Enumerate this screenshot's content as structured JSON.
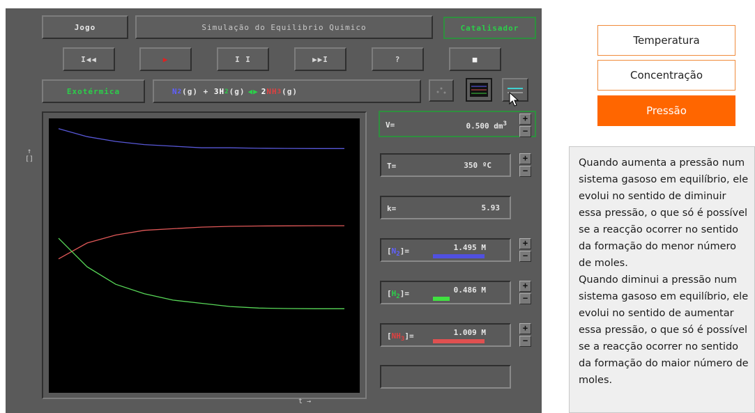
{
  "sim": {
    "jogo_button": "Jogo",
    "title": "Simulação do Equilibrio Quimico",
    "catalyst_button": "Catalisador",
    "exothermic_label": "Exotérmica",
    "media_buttons": {
      "rewind": "I◀◀",
      "play": "▶",
      "pause": "I I",
      "fast_forward": "▶▶I",
      "help": "?",
      "stop": "■"
    },
    "equation": {
      "n2": "N",
      "n2_sub": "2",
      "n2_state": "(g) + ",
      "h2_coef": "3H",
      "h2_sub": "2",
      "h2_state": "(g) ",
      "arrow": "◀▶",
      "nh3_coef": "2",
      "nh3": "NH",
      "nh3_sub": "3",
      "nh3_state": "(g)"
    },
    "axis_y": "↑\n[]",
    "axis_x": "t →",
    "readouts": {
      "V": {
        "label": "V=",
        "value": "0.500 dm",
        "unit_sup": "3"
      },
      "T": {
        "label": "T=",
        "value": "350 ºC"
      },
      "K": {
        "label": "k=",
        "value": "5.93"
      },
      "N2": {
        "label_open": "[",
        "label_species": "N",
        "label_sub": "2",
        "label_close": "]=",
        "value": "1.495 M",
        "level": 0.74
      },
      "H2": {
        "label_open": "[",
        "label_species": "H",
        "label_sub": "2",
        "label_close": "]=",
        "value": "0.486 M",
        "level": 0.24
      },
      "NH3": {
        "label_open": "[",
        "label_species": "NH",
        "label_sub": "3",
        "label_close": "]=",
        "value": "1.009 M",
        "level": 0.74
      }
    },
    "stepper_plus": "+",
    "stepper_minus": "−"
  },
  "chart_data": {
    "type": "line",
    "title": "",
    "xlabel": "t",
    "ylabel": "[]",
    "x": [
      0,
      1,
      2,
      3,
      4,
      5,
      6,
      7,
      8,
      9,
      10
    ],
    "series": [
      {
        "values": [
          1.62,
          1.57,
          1.54,
          1.52,
          1.51,
          1.5,
          1.5,
          1.497,
          1.496,
          1.495,
          1.495
        ],
        "color": "#5858d8"
      },
      {
        "values": [
          0.8,
          0.9,
          0.95,
          0.98,
          0.99,
          1.0,
          1.005,
          1.007,
          1.008,
          1.009,
          1.009
        ],
        "color": "#e05858"
      },
      {
        "values": [
          0.93,
          0.75,
          0.64,
          0.58,
          0.54,
          0.52,
          0.5,
          0.49,
          0.487,
          0.486,
          0.486
        ],
        "color": "#58d858"
      }
    ],
    "ylim": [
      0,
      1.65
    ],
    "grid": false
  },
  "right_panel": {
    "tabs": [
      "Temperatura",
      "Concentração",
      "Pressão"
    ],
    "active_tab": "Pressão",
    "accent": "#ff6600",
    "info_paragraphs": [
      "Quando aumenta a pressão num sistema gasoso em equilíbrio, ele evolui no sentido de diminuir essa pressão, o que só é possível se a reacção ocorrer no sentido da formação do menor número de moles.",
      "Quando diminui a pressão num sistema gasoso em equilíbrio, ele evolui no sentido de aumentar essa pressão, o que só é possível se a reacção ocorrer no sentido da formação do maior número de moles."
    ]
  }
}
